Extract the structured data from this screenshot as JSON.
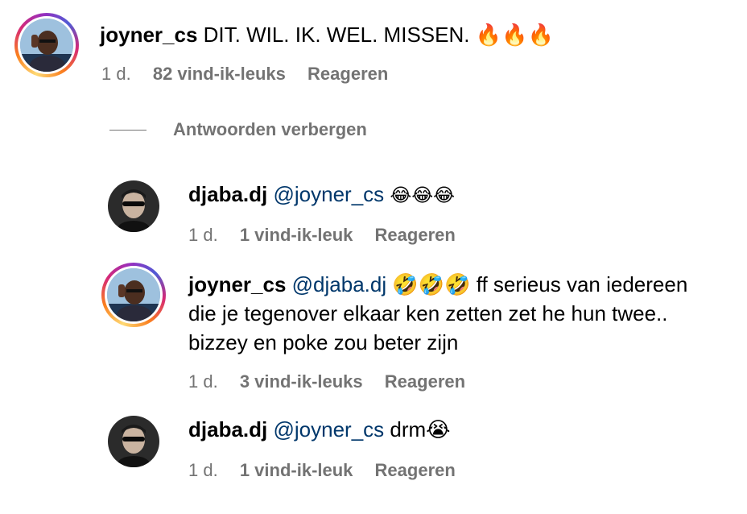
{
  "comments": [
    {
      "username": "joyner_cs",
      "text": "DIT. WIL. IK. WEL. MISSEN. 🔥🔥🔥",
      "time": "1 d.",
      "likes": "82 vind-ik-leuks",
      "reply": "Reageren"
    },
    {
      "username": "djaba.dj",
      "mention": "@joyner_cs",
      "text": "😂😂😂",
      "time": "1 d.",
      "likes": "1 vind-ik-leuk",
      "reply": "Reageren"
    },
    {
      "username": "joyner_cs",
      "mention": "@djaba.dj",
      "text_line1": "🤣🤣🤣 ff serieus van iedereen",
      "text_line2": "die je tegenover elkaar ken zetten zet he hun twee..",
      "text_line3": "bizzey en poke zou beter zijn",
      "time": "1 d.",
      "likes": "3 vind-ik-leuks",
      "reply": "Reageren"
    },
    {
      "username": "djaba.dj",
      "mention": "@joyner_cs",
      "text": "drm😭",
      "time": "1 d.",
      "likes": "1 vind-ik-leuk",
      "reply": "Reageren"
    }
  ],
  "hide_replies_label": "Antwoorden verbergen",
  "icons": {
    "story_ring": "story-ring",
    "avatar": "profile-picture"
  },
  "colors": {
    "mention": "#00376b",
    "meta": "#737373"
  }
}
